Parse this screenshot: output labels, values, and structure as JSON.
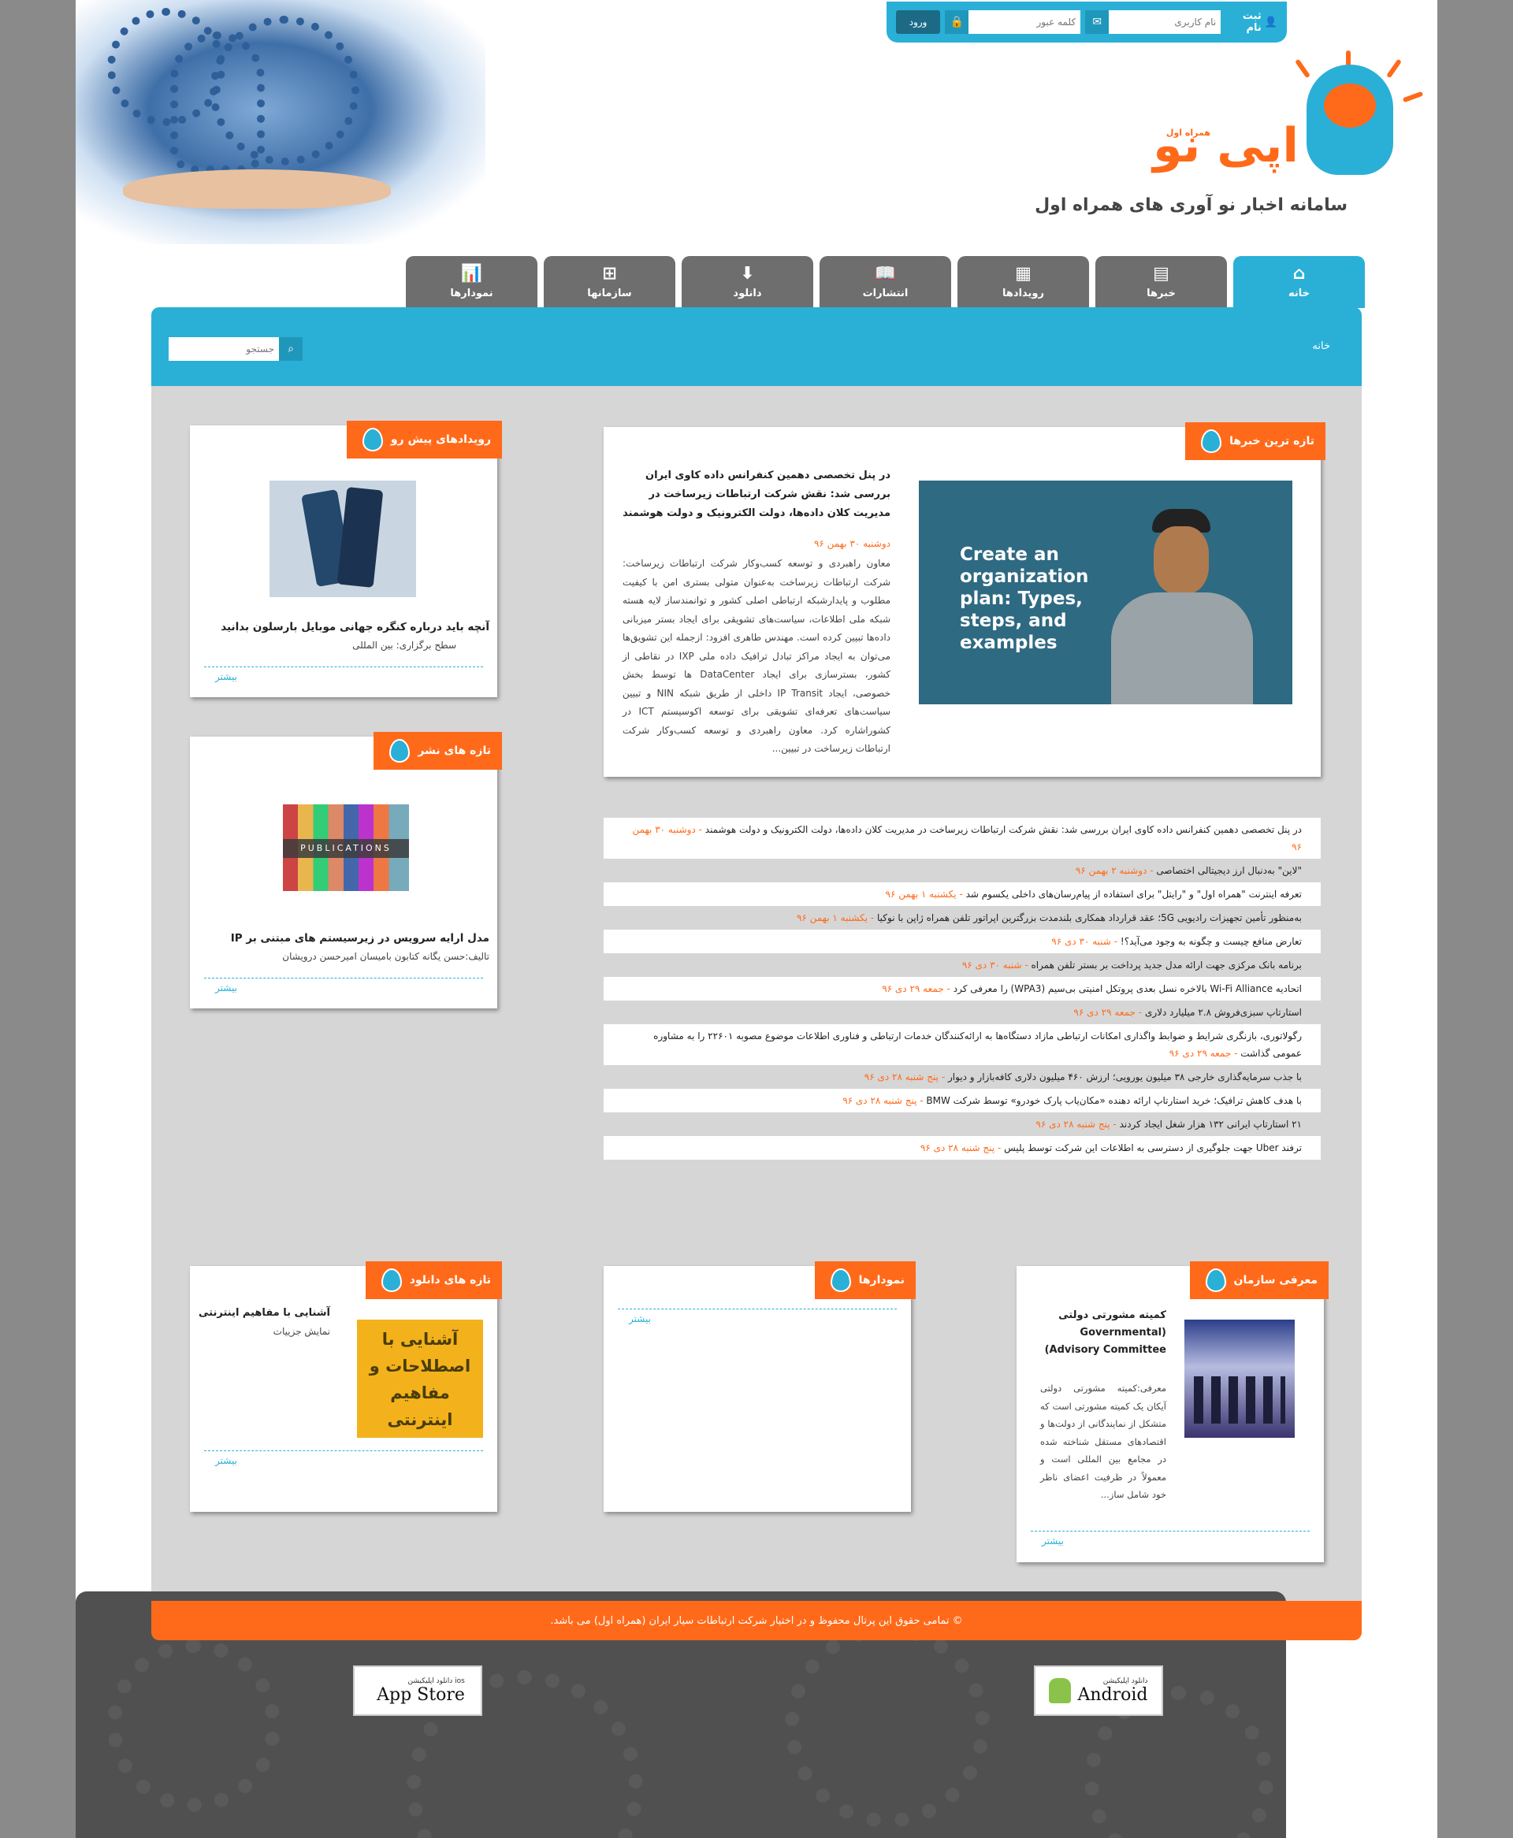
{
  "login": {
    "register_label": "ثبت نام",
    "username_placeholder": "نام کاربری",
    "password_placeholder": "کلمه عبور",
    "submit_label": "ورود"
  },
  "brand": {
    "logo_text": "اپی نو",
    "logo_mark": "همراه اول",
    "subtitle": "سامانه اخبار نو آوری های همراه اول"
  },
  "nav": {
    "tabs": [
      {
        "label": "خانه",
        "icon": "home-icon"
      },
      {
        "label": "خبرها",
        "icon": "newspaper-icon"
      },
      {
        "label": "رویدادها",
        "icon": "calendar-icon"
      },
      {
        "label": "انتشارات",
        "icon": "book-icon"
      },
      {
        "label": "دانلود",
        "icon": "download-icon"
      },
      {
        "label": "سازمانها",
        "icon": "sitemap-icon"
      },
      {
        "label": "نمودارها",
        "icon": "chart-icon"
      }
    ]
  },
  "breadcrumb": {
    "home": "خانه"
  },
  "search": {
    "placeholder": "جستجو"
  },
  "latest_news": {
    "title": "تازه ترین خبرها",
    "headline": "در پنل تخصصی دهمین کنفرانس داده کاوی ایران بررسی شد: نقش شرکت ارتباطات زیرساخت در مدیریت کلان داده‌ها، دولت الکترونیک و دولت هوشمند",
    "date": "دوشنبه ۳۰ بهمن ۹۶",
    "body": "معاون راهبردی و توسعه کسب‌وکار شرکت ارتباطات زیرساخت: شرکت ارتباطات زیرساخت به‌عنوان متولی بستری امن با کیفیت مطلوب و پایدارشبکه ارتباطی اصلی کشور و توانمندساز لایه هسته شبکه ملی اطلاعات، سیاست‌های تشویقی برای ایجاد بستر میزبانی داده‌ها تبیین کرده است. مهندس طاهری افزود: ازجمله این تشویق‌ها می‌توان به ایجاد مراکز تبادل ترافیک داده ملی IXP در نقاطی از کشور، بسترسازی برای ایجاد DataCenter ها توسط بخش خصوصی، ایجاد IP Transit داخلی از طریق شبکه NIN و تبیین سیاست‌های تعرفه‌ای تشویقی برای توسعه اکوسیستم ICT در کشوراشاره کرد. معاون راهبردی و توسعه کسب‌وکار شرکت ارتباطات زیرساخت در تبیین...",
    "image_text": "Create an organization plan: Types, steps, and examples"
  },
  "news_list": [
    {
      "text": "در پنل تخصصی دهمین کنفرانس داده کاوی ایران بررسی شد: نقش شرکت ارتباطات زیرساخت در مدیریت کلان داده‌ها، دولت الکترونیک و دولت هوشمند",
      "date": "دوشنبه ۳۰ بهمن ۹۶"
    },
    {
      "text": "\"لاین\" به‌دنبال ارز دیجیتالی اختصاصی",
      "date": "دوشنبه ۲ بهمن ۹۶"
    },
    {
      "text": "تعرفه اینترنت \"همراه اول\" و \"رایتل\" برای استفاده از پیام‌رسان‌های داخلی یکسوم شد",
      "date": "یکشنبه ۱ بهمن ۹۶"
    },
    {
      "text": "به‌منظور تأمین تجهیزات رادیویی 5G؛ عقد قرارداد همکاری بلندمدت بزرگترین اپراتور تلفن همراه ژاپن با نوکیا",
      "date": "یکشنبه ۱ بهمن ۹۶"
    },
    {
      "text": "تعارض منافع چیست و چگونه به وجود می‌آید؟!",
      "date": "شنبه ۳۰ دی ۹۶"
    },
    {
      "text": "برنامه بانک مرکزی جهت ارائه مدل جدید پرداخت بر بستر تلفن همراه",
      "date": "شنبه ۳۰ دی ۹۶"
    },
    {
      "text": "اتحادیه Wi-Fi Alliance بالاخره نسل بعدی پروتکل امنیتی بی‌سیم (WPA3) را معرفی کرد",
      "date": "جمعه ۲۹ دی ۹۶"
    },
    {
      "text": "استارتاپ سبزی‌فروش ۲.۸ میلیارد دلاری",
      "date": "جمعه ۲۹ دی ۹۶"
    },
    {
      "text": "رگولاتوری، بازنگری شرایط و ضوابط واگذاری امکانات ارتباطی مازاد دستگاه‌ها به ارائه‌کنندگان خدمات ارتباطی و فناوری اطلاعات موضوع مصوبه ۲۲۶۰۱ را به مشاوره عمومی گذاشت",
      "date": "جمعه ۲۹ دی ۹۶"
    },
    {
      "text": "با جذب سرمایه‌گذاری خارجی ۳۸ میلیون یورویی؛ ارزش ۴۶۰ میلیون دلاری کافه‌بازار و دیوار",
      "date": "پنج شنبه ۲۸ دی ۹۶"
    },
    {
      "text": "با هدف کاهش ترافیک؛ خرید استارتاپ ارائه دهنده «مکان‌یاب پارک خودرو» توسط شرکت BMW",
      "date": "پنج شنبه ۲۸ دی ۹۶"
    },
    {
      "text": "۲۱ استارتاپ ایرانی ۱۳۲ هزار شغل ایجاد کردند",
      "date": "پنج شنبه ۲۸ دی ۹۶"
    },
    {
      "text": "ترفند Uber جهت جلوگیری از دسترسی به اطلاعات این شرکت توسط پلیس",
      "date": "پنج شنبه ۲۸ دی ۹۶"
    }
  ],
  "upcoming_events": {
    "title": "رویدادهای پیش رو",
    "item_title": "آنچه باید درباره کنگره جهانی موبایل بارسلون بدانید",
    "item_sub": "سطح برگزاری: بین المللی",
    "more": "بیشتر"
  },
  "latest_publications": {
    "title": "تازه های نشر",
    "item_title": "مدل ارایه سرویس در زیرسیستم های مبتنی بر IP",
    "item_sub": "تالیف:حسن یگانه کتابون بامیسان امیرحسن درویشان",
    "image_text": "PUBLICATIONS",
    "more": "بیشتر"
  },
  "latest_downloads": {
    "title": "تازه های دانلود",
    "item_title": "آشنایی با مفاهیم اینترنتی",
    "item_sub": "نمایش جزییات",
    "image_text": "آشنایی با اصطلاحات و مفاهیم اینترنتی",
    "more": "بیشتر"
  },
  "charts_box": {
    "title": "نمودارها",
    "more": "بیشتر"
  },
  "org_intro": {
    "title": "معرفی سازمان",
    "item_title": "کمیته مشورتی دولتی (Governmental Advisory Committee)",
    "item_body": "معرفی:کمیته مشورتی دولتی آیکان یک کمیته مشورتی است که متشکل از نمایندگانی از دولت‌ها و اقتصادهای مستقل شناخته شده در مجامع بین المللی است و معمولاً در ظرفیت اعضای ناظر خود شامل ساز...",
    "more": "بیشتر"
  },
  "footer": {
    "copyright": "© تمامی حقوق این پرتال محفوظ و در اختیار شرکت ارتباطات سیار ایران (همراه اول) می باشد.",
    "ios_small": "دانلود اپلیکیشن ios",
    "ios_big": "App Store",
    "android_small": "دانلود اپلیکیشن",
    "android_big": "Android"
  },
  "colors": {
    "accent_blue": "#2ab0d7",
    "accent_orange": "#ff6a1a",
    "tab_gray": "#6e6e6e"
  }
}
